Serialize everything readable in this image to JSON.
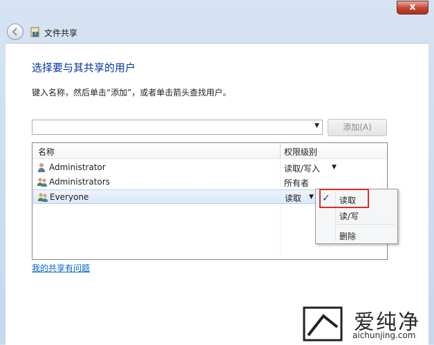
{
  "window": {
    "title": "文件共享",
    "close_glyph": "x"
  },
  "main": {
    "heading": "选择要与其共享的用户",
    "instruction": "键入名称，然后单击“添加”，或者单击箭头查找用户。",
    "name_input": {
      "value": ""
    },
    "add_button_label": "添加(A)",
    "help_link": "我的共享有问题"
  },
  "list": {
    "columns": [
      "名称",
      "权限级别"
    ],
    "rows": [
      {
        "name": "Administrator",
        "permission": "读取/写入",
        "icon": "user-icon"
      },
      {
        "name": "Administrators",
        "permission": "所有者",
        "icon": "users-group-icon"
      },
      {
        "name": "Everyone",
        "permission": "读取",
        "icon": "users-group-icon",
        "selected": true
      }
    ]
  },
  "context_menu": {
    "items": [
      {
        "label": "读取",
        "checked": true
      },
      {
        "label": "读/写",
        "checked": false
      },
      {
        "label": "删除",
        "checked": false
      }
    ],
    "check_glyph": "✓"
  },
  "watermark": {
    "text": "爱纯净",
    "url": "aichunjing.com"
  },
  "colors": {
    "heading": "#003399",
    "link": "#0066cc",
    "highlight": "#e02a2a",
    "close": "#c2452f"
  }
}
